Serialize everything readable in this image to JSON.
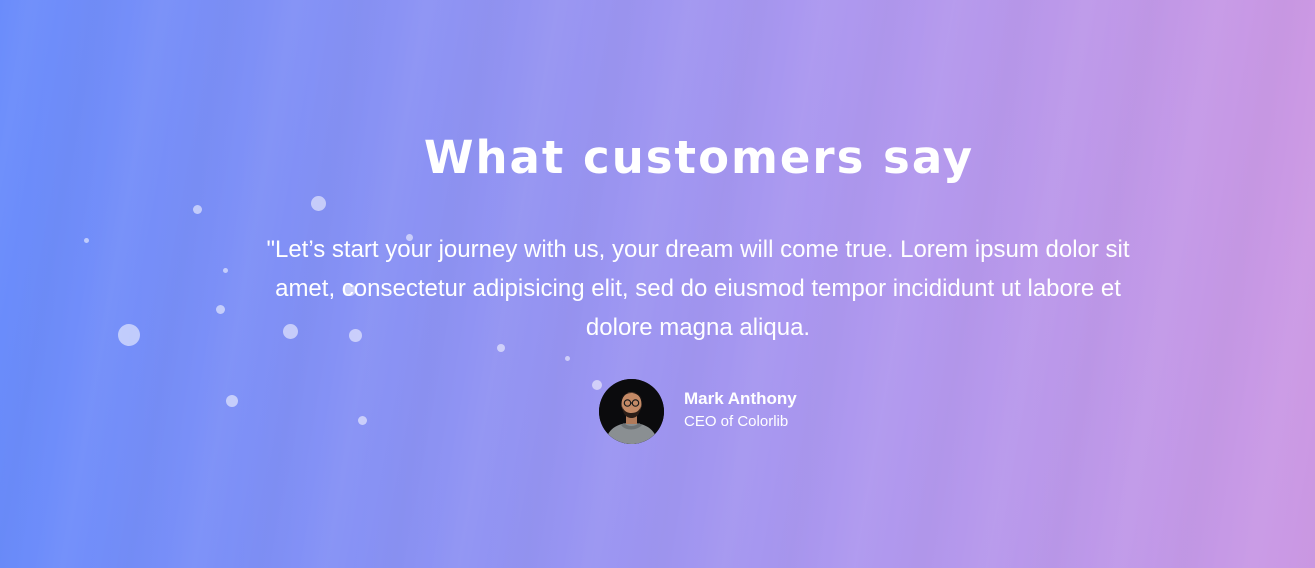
{
  "testimonial": {
    "heading": "What customers say",
    "quote": "\"Let’s start your journey with us, your dream will come true. Lorem ipsum dolor sit amet, consectetur adipisicing elit, sed do eiusmod tempor incididunt ut labore et dolore magna aliqua.",
    "author": {
      "name": "Mark Anthony",
      "role": "CEO of Colorlib",
      "avatar_icon": "person-photo-icon"
    }
  },
  "colors": {
    "gradient_start": "#6a8cfb",
    "gradient_end": "#cc99e4",
    "text": "#ffffff"
  }
}
